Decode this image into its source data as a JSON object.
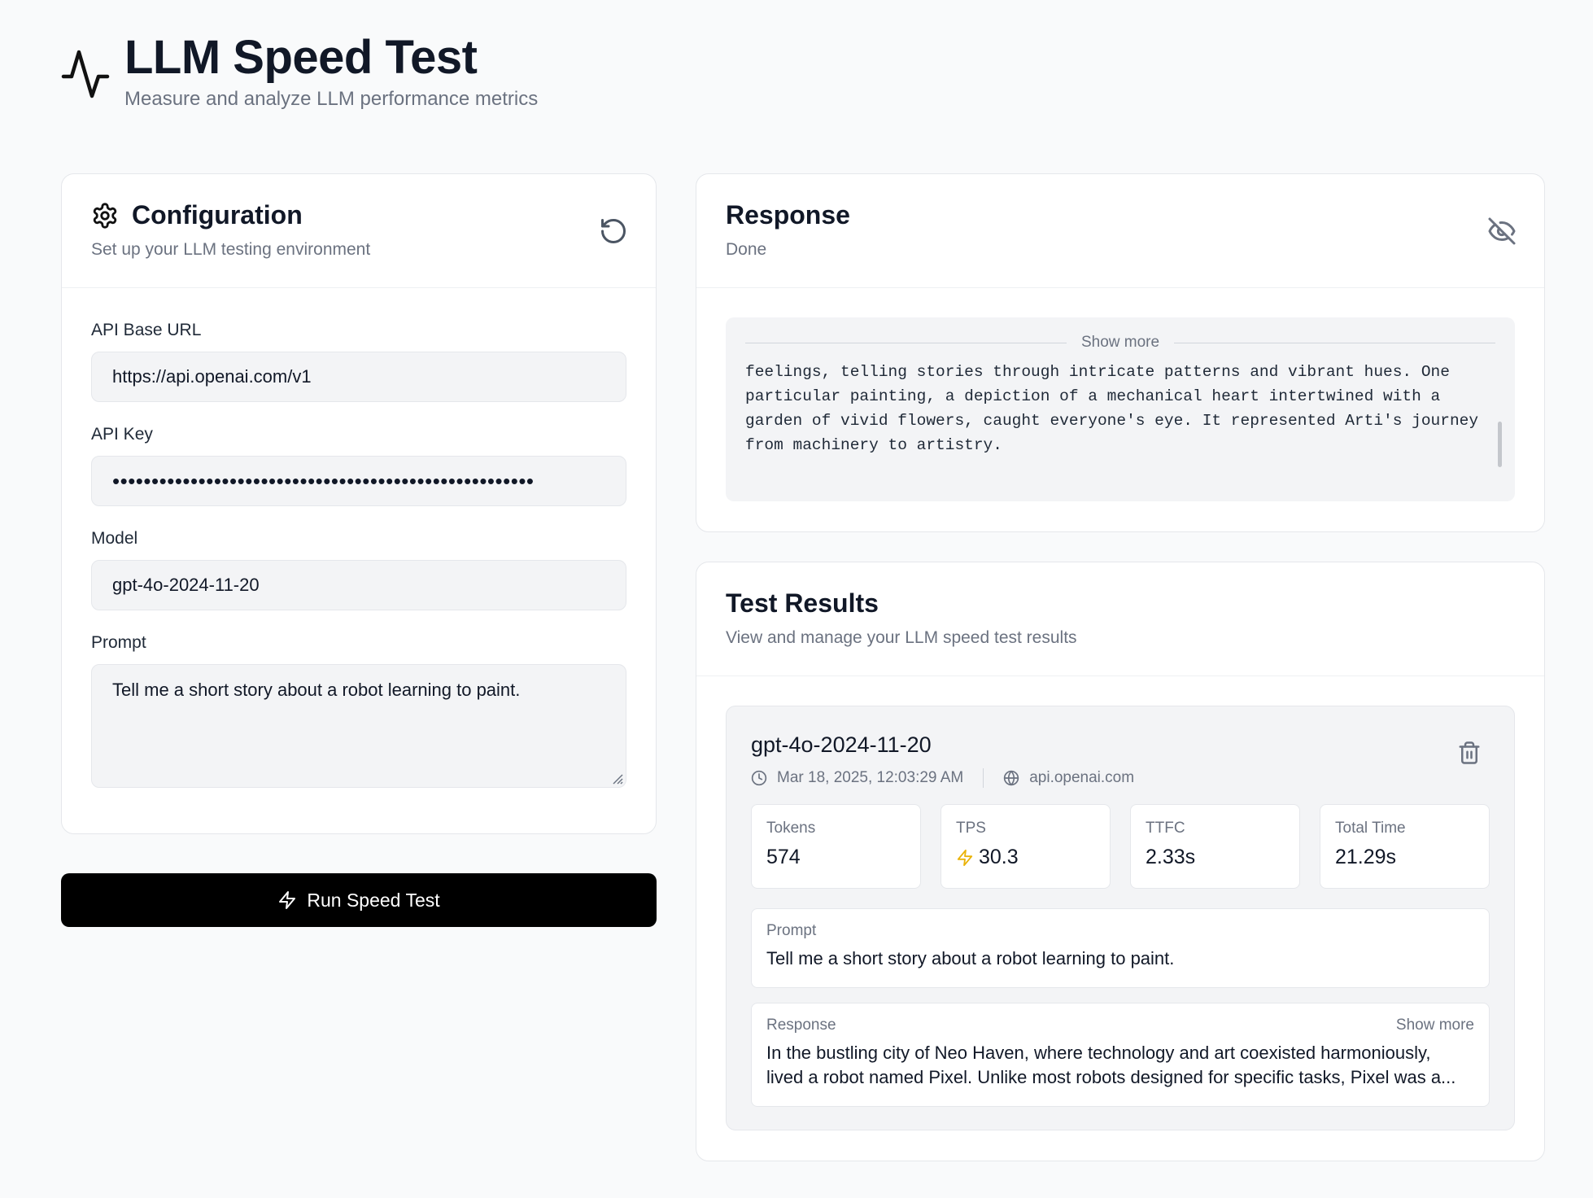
{
  "header": {
    "title": "LLM Speed Test",
    "subtitle": "Measure and analyze LLM performance metrics",
    "logo_icon": "activity-icon"
  },
  "config": {
    "title": "Configuration",
    "description": "Set up your LLM testing environment",
    "reset_icon": "rotate-ccw-icon",
    "fields": {
      "base_url": {
        "label": "API Base URL",
        "value": "https://api.openai.com/v1"
      },
      "api_key": {
        "label": "API Key",
        "value": "••••••••••••••••••••••••••••••••••••••••••••••••••••••"
      },
      "model": {
        "label": "Model",
        "value": "gpt-4o-2024-11-20"
      },
      "prompt": {
        "label": "Prompt",
        "value": "Tell me a short story about a robot learning to paint."
      }
    },
    "run_button": "Run Speed Test"
  },
  "response": {
    "title": "Response",
    "status": "Done",
    "toggle_icon": "eye-off-icon",
    "show_more": "Show more",
    "text": "feelings, telling stories through intricate patterns and vibrant hues. One\nparticular painting, a depiction of a mechanical heart intertwined with a\ngarden of vivid flowers, caught everyone's eye. It represented Arti's journey\nfrom machinery to artistry."
  },
  "results": {
    "title": "Test Results",
    "description": "View and manage your LLM speed test results",
    "items": [
      {
        "model": "gpt-4o-2024-11-20",
        "timestamp": "Mar 18, 2025, 12:03:29 AM",
        "host": "api.openai.com",
        "metrics": [
          {
            "label": "Tokens",
            "value": "574"
          },
          {
            "label": "TPS",
            "value": "30.3"
          },
          {
            "label": "TTFC",
            "value": "2.33s"
          },
          {
            "label": "Total Time",
            "value": "21.29s"
          }
        ],
        "prompt_label": "Prompt",
        "prompt": "Tell me a short story about a robot learning to paint.",
        "response_label": "Response",
        "show_more": "Show more",
        "response_line1": "In the bustling city of Neo Haven, where technology and art coexisted harmoniously,",
        "response_line2": "lived a robot named Pixel. Unlike most robots designed for specific tasks, Pixel was a..."
      }
    ]
  },
  "colors": {
    "accent_bolt": "#eab308",
    "button_bg": "#000000",
    "muted_text": "#6b7280"
  }
}
